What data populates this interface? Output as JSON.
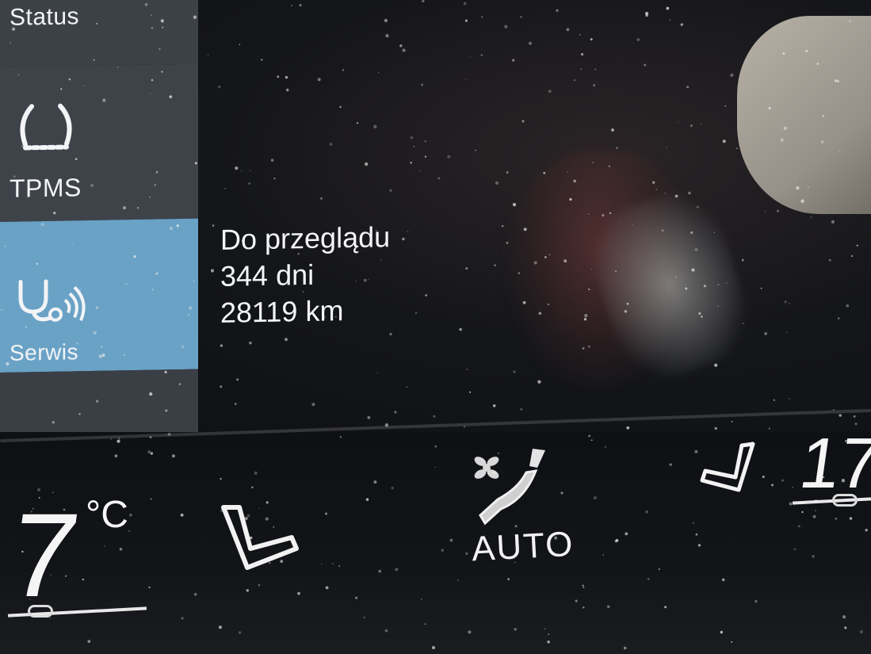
{
  "sidebar": {
    "items": [
      {
        "label": "Status"
      },
      {
        "label": "TPMS",
        "icon": "tire-pressure-icon"
      },
      {
        "label": "Serwis",
        "icon": "stethoscope-icon",
        "selected": true
      }
    ],
    "colors": {
      "item_bg": "#3e434a",
      "selected_bg": "#6aa2c6"
    }
  },
  "info": {
    "line1": "Do przeglądu",
    "line2": "344 dni",
    "line3": "28119 km"
  },
  "climate": {
    "left_temp": "7",
    "left_unit": "°C",
    "right_temp": "17",
    "fan_label": "AUTO",
    "icons": [
      "seat-heat-left-icon",
      "fan-airflow-icon",
      "seat-heat-right-icon"
    ]
  }
}
